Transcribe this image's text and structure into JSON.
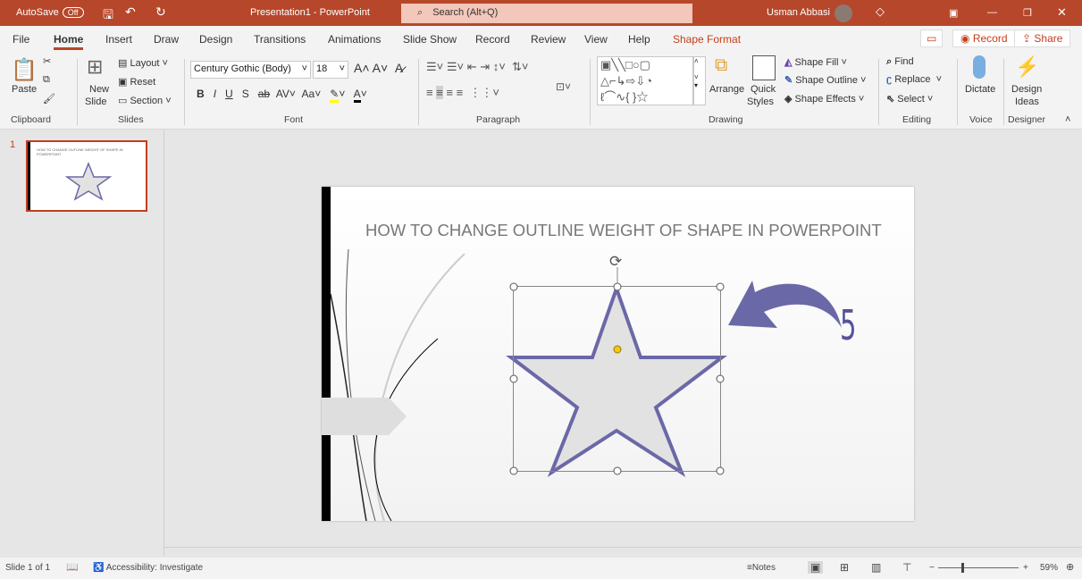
{
  "titlebar": {
    "autosave": "AutoSave",
    "autosave_state": "Off",
    "doc_title": "Presentation1  -  PowerPoint",
    "search_placeholder": "Search (Alt+Q)",
    "user": "Usman Abbasi"
  },
  "tabs": [
    "File",
    "Home",
    "Insert",
    "Draw",
    "Design",
    "Transitions",
    "Animations",
    "Slide Show",
    "Record",
    "Review",
    "View",
    "Help",
    "Shape Format"
  ],
  "actions": {
    "record": "Record",
    "share": "Share"
  },
  "ribbon": {
    "clipboard": {
      "paste": "Paste",
      "label": "Clipboard"
    },
    "slides": {
      "new_slide": "New",
      "new_slide2": "Slide",
      "layout": "Layout",
      "reset": "Reset",
      "section": "Section",
      "label": "Slides"
    },
    "font": {
      "font_name": "Century Gothic (Body)",
      "font_size": "18",
      "label": "Font"
    },
    "paragraph": {
      "label": "Paragraph"
    },
    "drawing": {
      "arrange": "Arrange",
      "quick_styles": "Quick",
      "quick_styles2": "Styles",
      "shape_fill": "Shape Fill",
      "shape_outline": "Shape Outline",
      "shape_effects": "Shape Effects",
      "label": "Drawing"
    },
    "editing": {
      "find": "Find",
      "replace": "Replace",
      "select": "Select",
      "label": "Editing"
    },
    "voice": {
      "dictate": "Dictate",
      "label": "Voice"
    },
    "designer": {
      "design_ideas": "Design",
      "design_ideas2": "Ideas",
      "label": "Designer"
    }
  },
  "thumbnail": {
    "number": "1",
    "title": "HOW TO CHANGE OUTLINE WEIGHT OF SHAPE IN POWERPOINT"
  },
  "slide": {
    "title": "HOW TO CHANGE OUTLINE WEIGHT OF SHAPE IN POWERPOINT",
    "annotation": "5",
    "star_outline_color": "#6b68a8",
    "star_fill_color": "#e2e2e2"
  },
  "status": {
    "slide_count": "Slide 1 of 1",
    "accessibility": "Accessibility: Investigate",
    "notes": "Notes",
    "zoom": "59%"
  }
}
